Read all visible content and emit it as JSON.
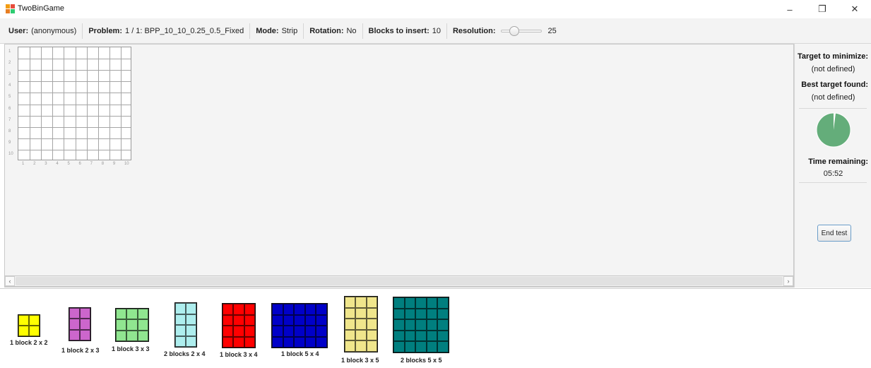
{
  "window": {
    "title": "TwoBinGame",
    "controls": {
      "minimize": "–",
      "maximize": "❐",
      "close": "✕"
    }
  },
  "toolbar": {
    "user_label": "User:",
    "user_value": "(anonymous)",
    "problem_label": "Problem:",
    "problem_value": "1 / 1: BPP_10_10_0.25_0.5_Fixed",
    "mode_label": "Mode:",
    "mode_value": "Strip",
    "rotation_label": "Rotation:",
    "rotation_value": "No",
    "blocks_label": "Blocks to insert:",
    "blocks_value": "10",
    "resolution_label": "Resolution:",
    "resolution_value": "25",
    "resolution_slider_fraction": 0.27
  },
  "bin": {
    "columns": 10,
    "rows": 10,
    "row_labels": [
      "1",
      "2",
      "3",
      "4",
      "5",
      "6",
      "7",
      "8",
      "9",
      "10"
    ],
    "col_labels": [
      "1",
      "2",
      "3",
      "4",
      "5",
      "6",
      "7",
      "8",
      "9",
      "10"
    ]
  },
  "right_panel": {
    "target_label": "Target to minimize:",
    "target_value": "(not defined)",
    "best_label": "Best target found:",
    "best_value": "(not defined)",
    "timer_fraction_elapsed": 0.02,
    "timer_color": "#64ad7a",
    "time_label": "Time remaining:",
    "time_value": "05:52",
    "end_button": "End test"
  },
  "palette": {
    "blocks": [
      {
        "label": "1 block 2 x 2",
        "cols": 2,
        "rows": 2,
        "color": "#ffff00"
      },
      {
        "label": "1 block 2 x 3",
        "cols": 2,
        "rows": 3,
        "color": "#cc66cc"
      },
      {
        "label": "1 block 3 x 3",
        "cols": 3,
        "rows": 3,
        "color": "#90e690"
      },
      {
        "label": "2 blocks 2 x 4",
        "cols": 2,
        "rows": 4,
        "color": "#aeeeee"
      },
      {
        "label": "1 block 3 x 4",
        "cols": 3,
        "rows": 4,
        "color": "#ff0000"
      },
      {
        "label": "1 block 5 x 4",
        "cols": 5,
        "rows": 4,
        "color": "#0000c8"
      },
      {
        "label": "1 block 3 x 5",
        "cols": 3,
        "rows": 5,
        "color": "#f0e68c"
      },
      {
        "label": "2 blocks 5 x 5",
        "cols": 5,
        "rows": 5,
        "color": "#007f7f"
      }
    ]
  }
}
